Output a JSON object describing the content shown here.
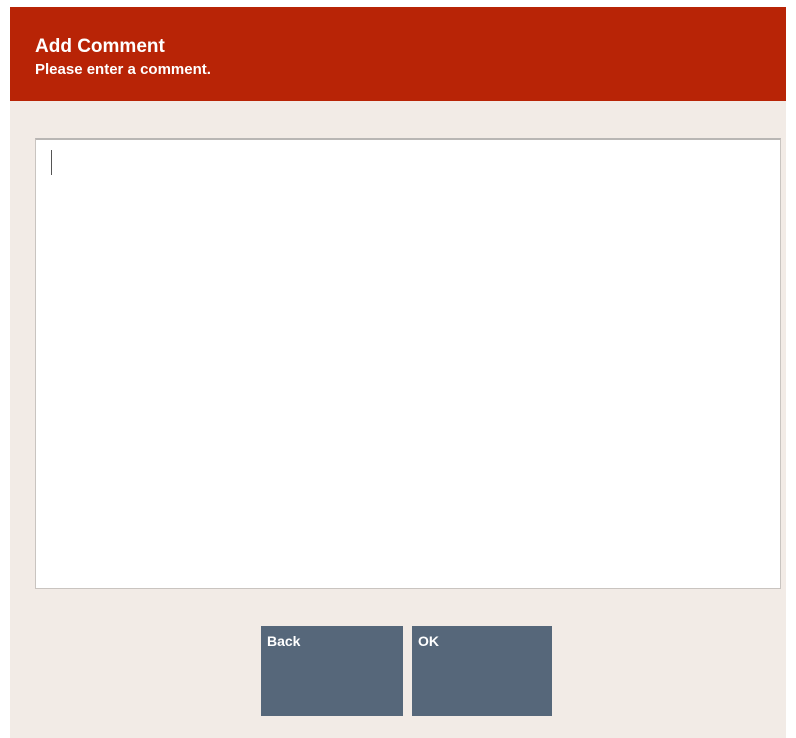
{
  "dialog": {
    "title": "Add Comment",
    "subtitle": "Please enter a comment.",
    "comment": {
      "value": "",
      "placeholder": ""
    },
    "buttons": {
      "back_label": "Back",
      "ok_label": "OK"
    }
  },
  "colors": {
    "header_bg": "#b82406",
    "dialog_bg": "#f2ebe6",
    "button_bg": "#56677a",
    "text_light": "#ffffff"
  }
}
